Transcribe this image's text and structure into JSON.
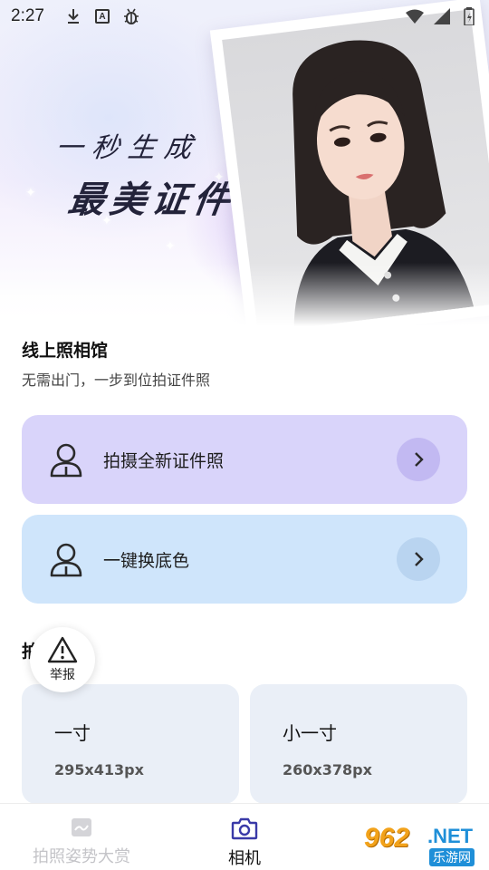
{
  "status_bar": {
    "time": "2:27",
    "left_icons": [
      "download-icon",
      "a-badge-icon",
      "bug-icon"
    ],
    "a_badge_text": "A",
    "right_icons": [
      "wifi-icon",
      "signal-icon",
      "battery-icon"
    ]
  },
  "hero": {
    "slogan_line1": "一秒生成",
    "slogan_line2": "最美证件照"
  },
  "intro": {
    "title": "线上照相馆",
    "subtitle": "无需出门，一步到位拍证件照"
  },
  "actions": [
    {
      "label": "拍摄全新证件照",
      "color": "#d9d4fa"
    },
    {
      "label": "一键换底色",
      "color": "#cfe5fb"
    }
  ],
  "section": {
    "title_visible": "拍"
  },
  "report": {
    "label": "举报"
  },
  "sizes": [
    {
      "name": "一寸",
      "dimensions": "295x413px"
    },
    {
      "name": "小一寸",
      "dimensions": "260x378px"
    }
  ],
  "bottom_nav": [
    {
      "label": "拍照姿势大赏",
      "active": false
    },
    {
      "label": "相机",
      "active": true
    }
  ],
  "watermark": {
    "number": "962",
    "domain": ".NET",
    "site": "乐游网"
  },
  "colors": {
    "accent": "#3a3aa8",
    "inactive": "#c4c4c8"
  }
}
